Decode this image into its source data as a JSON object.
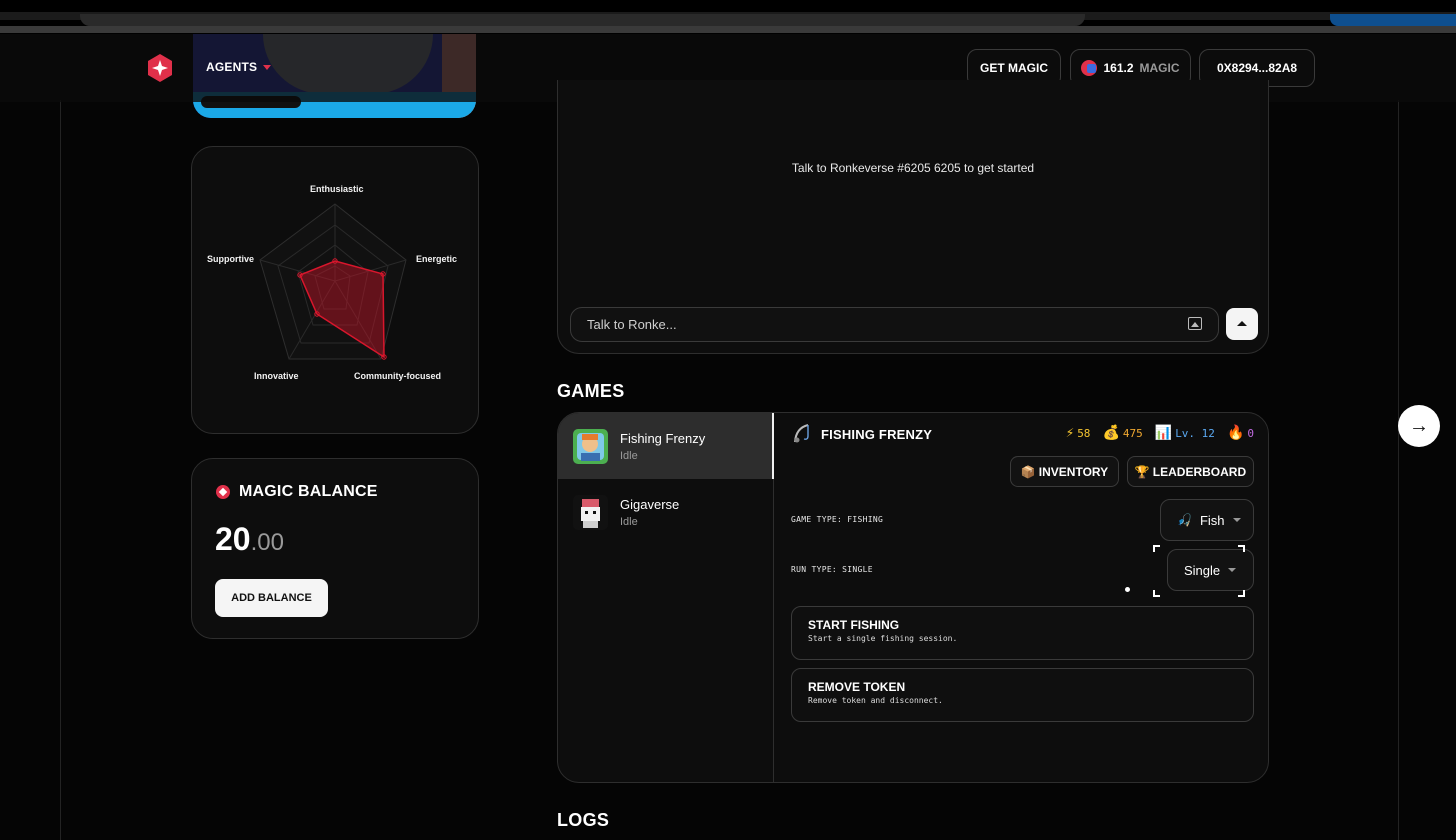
{
  "header": {
    "nav_label": "AGENTS",
    "get_magic_label": "GET MAGIC",
    "magic_balance_value": "161.2",
    "magic_unit": "MAGIC",
    "wallet_address": "0X8294...82A8"
  },
  "personality": {
    "traits": [
      "Enthusiastic",
      "Energetic",
      "Community-focused",
      "Innovative",
      "Supportive"
    ]
  },
  "balance": {
    "title": "MAGIC BALANCE",
    "whole": "20",
    "decimal": ".00",
    "add_label": "ADD BALANCE"
  },
  "chat": {
    "empty_message": "Talk to Ronkeverse #6205 6205 to get started",
    "input_placeholder": "Talk to Ronke..."
  },
  "games": {
    "section_title": "GAMES",
    "list": [
      {
        "name": "Fishing Frenzy",
        "status": "Idle"
      },
      {
        "name": "Gigaverse",
        "status": "Idle"
      }
    ],
    "panel": {
      "title": "FISHING FRENZY",
      "stats": [
        {
          "icon": "lightning-icon",
          "value": "58"
        },
        {
          "icon": "money-bag-icon",
          "value": "475"
        },
        {
          "icon": "chart-icon",
          "value": "Lv. 12"
        },
        {
          "icon": "fire-icon",
          "value": "0"
        }
      ],
      "inventory_label": "INVENTORY",
      "leaderboard_label": "LEADERBOARD",
      "game_type_label": "GAME TYPE: FISHING",
      "game_type_value": "Fish",
      "run_type_label": "RUN TYPE: SINGLE",
      "run_type_value": "Single",
      "actions": [
        {
          "title": "START FISHING",
          "desc": "Start a single fishing session."
        },
        {
          "title": "REMOVE TOKEN",
          "desc": "Remove token and disconnect."
        }
      ]
    }
  },
  "logs": {
    "section_title": "LOGS"
  },
  "colors": {
    "accent": "#e0304a",
    "background": "#050505"
  }
}
